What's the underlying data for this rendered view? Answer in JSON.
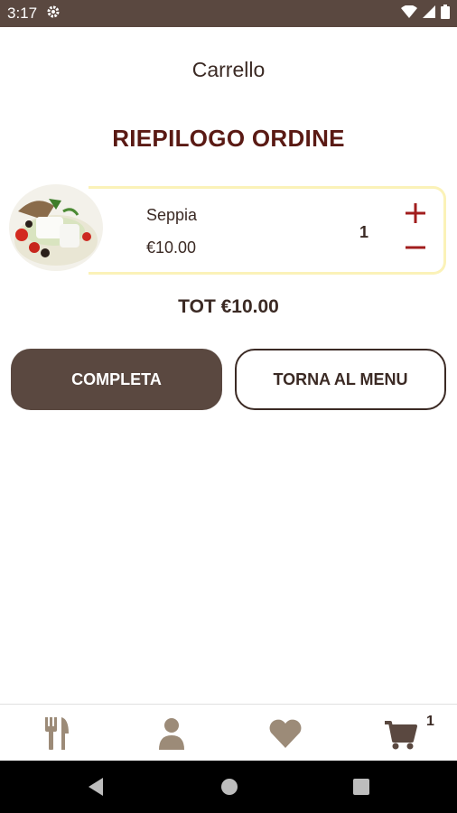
{
  "status_bar": {
    "time": "3:17"
  },
  "header": {
    "title": "Carrello"
  },
  "summary": {
    "title": "RIEPILOGO ORDINE"
  },
  "cart_items": [
    {
      "name": "Seppia",
      "price": "€10.00",
      "quantity": "1"
    }
  ],
  "total": "TOT €10.00",
  "buttons": {
    "complete": "COMPLETA",
    "back_to_menu": "TORNA AL MENU"
  },
  "bottom_nav": {
    "items": [
      "fork-knife-icon",
      "person-icon",
      "heart-icon",
      "cart-icon"
    ],
    "cart_badge": "1"
  },
  "colors": {
    "primary": "#5a4840",
    "title_red": "#5a1a14",
    "qty_red": "#a11d1d",
    "card_border": "#fbf2b8",
    "icon_tan": "#9c8b78"
  }
}
